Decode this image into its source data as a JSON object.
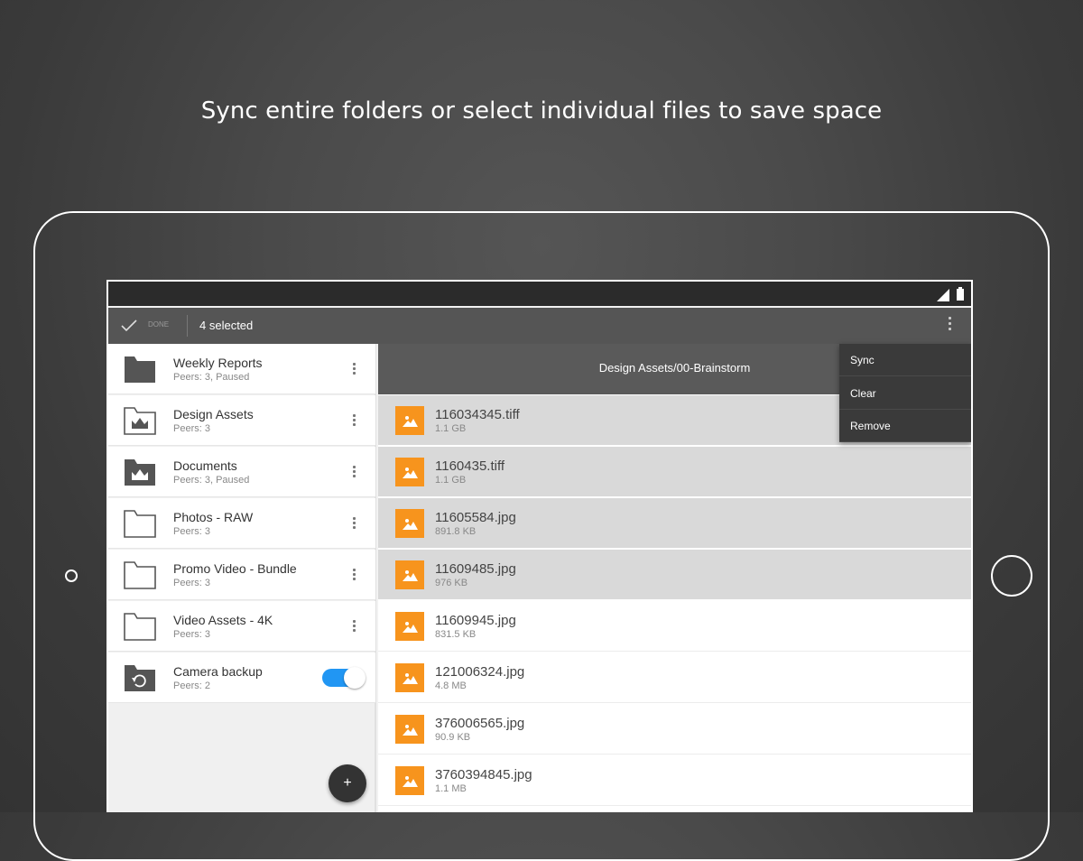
{
  "headline": "Sync entire folders or select individual files to save space",
  "actionbar": {
    "done_label": "DONE",
    "title": "4 selected",
    "overflow_icon": "more-vert-icon"
  },
  "folders": [
    {
      "name": "Weekly Reports",
      "sub": "Peers: 3, Paused",
      "icon": "folder-filled-icon"
    },
    {
      "name": "Design Assets",
      "sub": "Peers: 3",
      "icon": "folder-crown-outline-icon"
    },
    {
      "name": "Documents",
      "sub": "Peers: 3, Paused",
      "icon": "folder-crown-filled-icon"
    },
    {
      "name": "Photos - RAW",
      "sub": "Peers: 3",
      "icon": "folder-outline-icon"
    },
    {
      "name": "Promo Video - Bundle",
      "sub": "Peers: 3",
      "icon": "folder-outline-icon"
    },
    {
      "name": "Video Assets - 4K",
      "sub": "Peers: 3",
      "icon": "folder-outline-icon"
    },
    {
      "name": "Camera backup",
      "sub": "Peers: 2",
      "icon": "camera-backup-folder-icon",
      "toggle_on": true
    }
  ],
  "fab_label": "+",
  "path_title": "Design Assets/00-Brainstorm",
  "files": [
    {
      "name": "116034345.tiff",
      "size": "1.1 GB",
      "selected": true
    },
    {
      "name": "1160435.tiff",
      "size": "1.1 GB",
      "selected": true
    },
    {
      "name": "11605584.jpg",
      "size": "891.8 KB",
      "selected": true
    },
    {
      "name": "11609485.jpg",
      "size": "976 KB",
      "selected": true
    },
    {
      "name": "11609945.jpg",
      "size": "831.5 KB",
      "selected": false
    },
    {
      "name": "121006324.jpg",
      "size": "4.8 MB",
      "selected": false
    },
    {
      "name": "376006565.jpg",
      "size": "90.9 KB",
      "selected": false
    },
    {
      "name": "3760394845.jpg",
      "size": "1.1 MB",
      "selected": false
    }
  ],
  "menu": {
    "items": [
      "Sync",
      "Clear",
      "Remove"
    ]
  },
  "colors": {
    "accent_orange": "#f7941d",
    "toggle_blue": "#2196f3",
    "selected_row": "#d9d9d9"
  }
}
